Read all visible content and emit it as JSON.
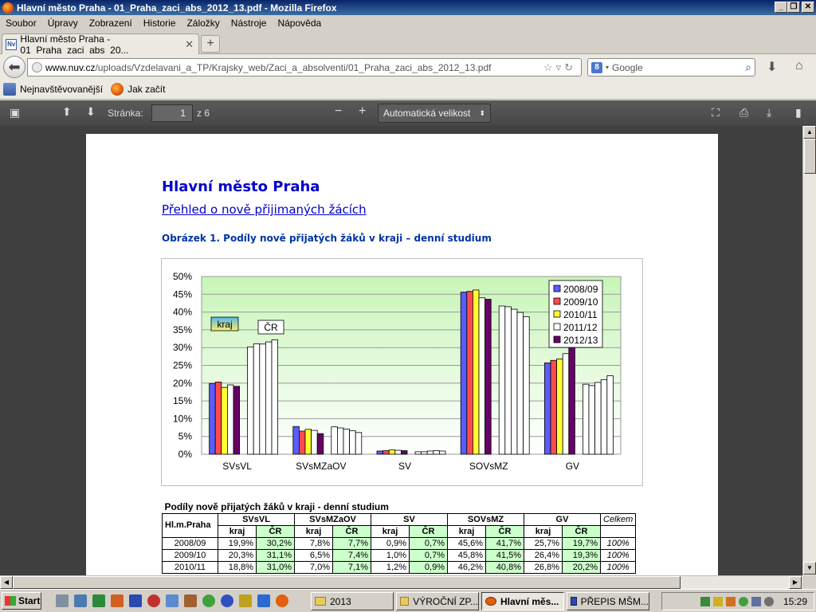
{
  "window": {
    "title": "Hlavní město Praha - 01_Praha_zaci_abs_2012_13.pdf - Mozilla Firefox"
  },
  "menu": [
    "Soubor",
    "Úpravy",
    "Zobrazení",
    "Historie",
    "Záložky",
    "Nástroje",
    "Nápověda"
  ],
  "tab": {
    "title": "Hlavní město Praha - 01_Praha_zaci_abs_20...",
    "icon": "nuv-favicon",
    "new_tab_label": "+"
  },
  "nav": {
    "url_host": "www.nuv.cz",
    "url_path": "/uploads/Vzdelavani_a_TP/Krajsky_web/Zaci_a_absolventi/01_Praha_zaci_abs_2012_13.pdf",
    "search_placeholder": "Google"
  },
  "bookmarks": [
    "Nejnavštěvovanější",
    "Jak začít"
  ],
  "pdf_toolbar": {
    "page_label": "Stránka:",
    "page_value": "1",
    "page_total": "z 6",
    "zoom": "Automatická velikost"
  },
  "document": {
    "title": "Hlavní město Praha",
    "subtitle": "Přehled o nově přijimaných žácích",
    "figure_caption": "Obrázek 1. Podíly nově přijatých žáků v kraji – denní studium"
  },
  "chart_data": {
    "type": "bar",
    "categories": [
      "SVsVL",
      "SVsMZaOV",
      "SV",
      "SOVsMZ",
      "GV"
    ],
    "ylim": [
      0,
      50
    ],
    "y_ticks": [
      "0%",
      "5%",
      "10%",
      "15%",
      "20%",
      "25%",
      "30%",
      "35%",
      "40%",
      "45%",
      "50%"
    ],
    "groups": [
      "kraj",
      "ČR"
    ],
    "series": [
      {
        "name": "2008/09",
        "color": "#5b5bff",
        "kraj": [
          19.9,
          7.8,
          0.9,
          45.6,
          25.7
        ],
        "CR": [
          30.2,
          7.7,
          0.7,
          41.7,
          19.7
        ]
      },
      {
        "name": "2009/10",
        "color": "#ff4b4b",
        "kraj": [
          20.3,
          6.5,
          1.0,
          45.8,
          26.4
        ],
        "CR": [
          31.1,
          7.4,
          0.7,
          41.5,
          19.3
        ]
      },
      {
        "name": "2010/11",
        "color": "#ffff33",
        "kraj": [
          18.8,
          7.0,
          1.2,
          46.2,
          26.8
        ],
        "CR": [
          31.0,
          7.1,
          0.9,
          40.8,
          20.2
        ]
      },
      {
        "name": "2011/12",
        "color": "#ffffff",
        "kraj": [
          19.5,
          6.7,
          1.1,
          44.0,
          28.3
        ],
        "CR": [
          31.6,
          6.6,
          1.0,
          39.9,
          21.0
        ]
      },
      {
        "name": "2012/13",
        "color": "#660066",
        "kraj": [
          19.1,
          5.8,
          1.0,
          43.6,
          31.0
        ],
        "CR": [
          32.2,
          6.1,
          0.9,
          38.7,
          22.1
        ]
      }
    ],
    "labels": {
      "kraj": "kraj",
      "cr": "ČR"
    },
    "grid": true,
    "legend_position": "top-right"
  },
  "table": {
    "caption": "Podíly nově přijatých žáků v kraji - denní studium",
    "corner": "Hl.m.Praha",
    "groups": [
      "SVsVL",
      "SVsMZaOV",
      "SV",
      "SOVsMZ",
      "GV"
    ],
    "total_header": "Celkem",
    "sub_kraj": "kraj",
    "sub_cr": "ČR",
    "rows": [
      {
        "year": "2008/09",
        "vals": [
          "19,9%",
          "30,2%",
          "7,8%",
          "7,7%",
          "0,9%",
          "0,7%",
          "45,6%",
          "41,7%",
          "25,7%",
          "19,7%"
        ],
        "total": "100%"
      },
      {
        "year": "2009/10",
        "vals": [
          "20,3%",
          "31,1%",
          "6,5%",
          "7,4%",
          "1,0%",
          "0,7%",
          "45,8%",
          "41,5%",
          "26,4%",
          "19,3%"
        ],
        "total": "100%"
      },
      {
        "year": "2010/11",
        "vals": [
          "18,8%",
          "31,0%",
          "7,0%",
          "7,1%",
          "1,2%",
          "0,9%",
          "46,2%",
          "40,8%",
          "26,8%",
          "20,2%"
        ],
        "total": "100%"
      }
    ]
  },
  "taskbar": {
    "start_label": "Start",
    "tasks": [
      "2013",
      "VÝROČNÍ ZP...",
      "Hlavní měs...",
      "PŘEPIS MŠM..."
    ],
    "clock": "15:29"
  }
}
